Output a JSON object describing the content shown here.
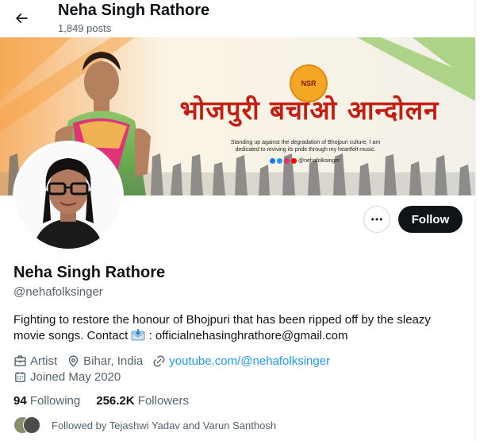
{
  "header": {
    "name": "Neha Singh Rathore",
    "posts": "1,849 posts"
  },
  "banner": {
    "title": "भोजपुरी बचाओ आन्दोलन",
    "logo": "NSR",
    "line1": "Standing up against the degradation of Bhojpuri culture, I am",
    "line2": "dedicated to reviving its pride through my heartfelt music.",
    "social_handle": "@nehafolksinger"
  },
  "actions": {
    "follow_label": "Follow"
  },
  "profile": {
    "name": "Neha Singh Rathore",
    "handle": "@nehafolksinger",
    "bio_line1": "Fighting to restore the honour of Bhojpuri that has been ripped off by the sleazy",
    "bio_line2_prefix": "movie songs. Contact",
    "bio_line2_suffix": ": officialnehasinghrathore@gmail.com",
    "category": "Artist",
    "location": "Bihar, India",
    "website": "youtube.com/@nehafolksinger",
    "joined": "Joined May 2020",
    "following_count": "94",
    "following_label": "Following",
    "followers_count": "256.2K",
    "followers_label": "Followers",
    "followed_by": "Followed by Tejashwi Yadav and Varun Santhosh"
  },
  "colors": {
    "accent": "#1d9bf0",
    "text_primary": "#0f1419",
    "text_secondary": "#536471",
    "follow_bg": "#0f1419",
    "banner_title": "#c41d12"
  },
  "icons": {
    "back": "arrow-left-icon",
    "more": "more-horizontal-icon",
    "category": "briefcase-icon",
    "location": "location-pin-icon",
    "website": "link-icon",
    "joined": "calendar-icon",
    "contact": "envelope-emoji-icon"
  }
}
